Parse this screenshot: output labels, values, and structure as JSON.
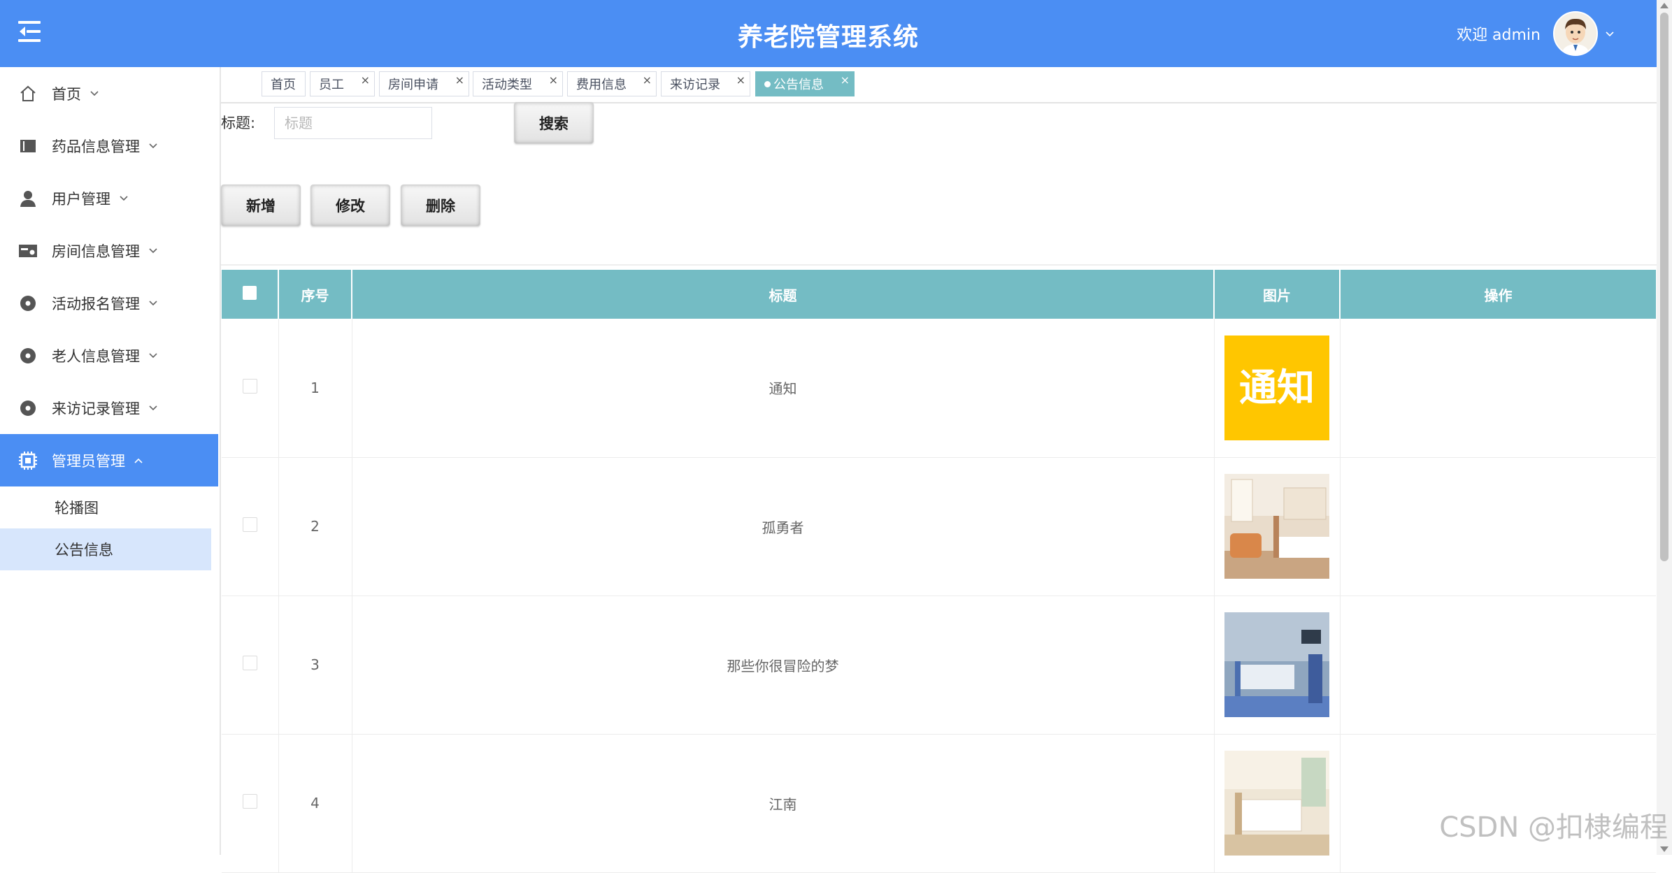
{
  "header": {
    "title": "养老院管理系统",
    "welcome": "欢迎 admin",
    "menu_icon": "hamburger-icon",
    "avatar": "avatar",
    "color": "#4b8ef3"
  },
  "sidebar": {
    "items": [
      {
        "label": "首页",
        "icon": "home-icon"
      },
      {
        "label": "药品信息管理",
        "icon": "book-icon"
      },
      {
        "label": "用户管理",
        "icon": "user-icon"
      },
      {
        "label": "房间信息管理",
        "icon": "card-icon"
      },
      {
        "label": "活动报名管理",
        "icon": "circle-icon"
      },
      {
        "label": "老人信息管理",
        "icon": "circle-icon"
      },
      {
        "label": "来访记录管理",
        "icon": "circle-icon"
      },
      {
        "label": "管理员管理",
        "icon": "chip-icon",
        "expanded": true
      }
    ],
    "sub_items": [
      {
        "label": "轮播图"
      },
      {
        "label": "公告信息",
        "active": true
      }
    ]
  },
  "tabs": [
    {
      "label": "首页",
      "closable": false
    },
    {
      "label": "员工",
      "closable": true
    },
    {
      "label": "房间申请",
      "closable": true
    },
    {
      "label": "活动类型",
      "closable": true
    },
    {
      "label": "费用信息",
      "closable": true
    },
    {
      "label": "来访记录",
      "closable": true
    },
    {
      "label": "公告信息",
      "closable": true,
      "active": true
    }
  ],
  "tab_close_glyph": "×",
  "search": {
    "label": "标题:",
    "placeholder": "标题",
    "value": "",
    "button": "搜索"
  },
  "actions": {
    "add": "新增",
    "edit": "修改",
    "delete": "删除"
  },
  "table": {
    "header_color": "#74bcc4",
    "columns": [
      "",
      "序号",
      "标题",
      "图片",
      "操作"
    ],
    "rows": [
      {
        "index": "1",
        "title": "通知",
        "image_text": "通知"
      },
      {
        "index": "2",
        "title": "孤勇者"
      },
      {
        "index": "3",
        "title": "那些你很冒险的梦"
      },
      {
        "index": "4",
        "title": "江南"
      }
    ]
  },
  "watermark": "CSDN @扣棣编程"
}
